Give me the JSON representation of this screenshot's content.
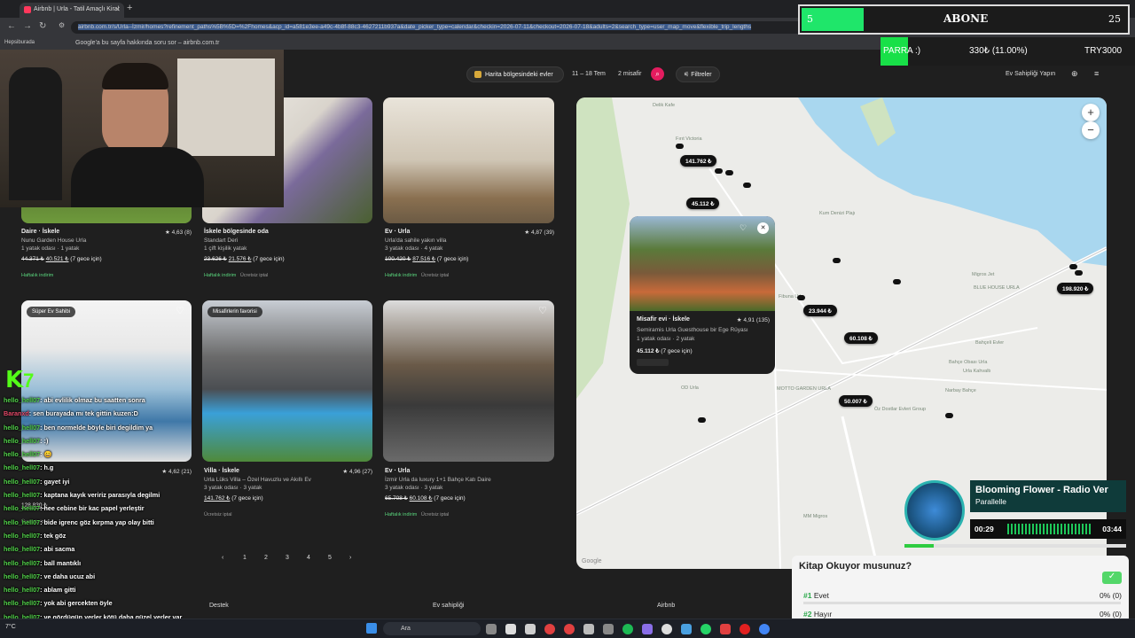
{
  "browser": {
    "tab_title": "Airbnb | Urla - Tatil Amaçlı Kiral",
    "url": "airbnb.com.tr/s/Urla--İzmir/homes?refinement_paths%5B%5D=%2Fhomes&acp_id=a581e3ee-a49c-4b8f-88c3-4627211b937a&date_picker_type=calendar&checkin=2026-07-11&checkout=2026-07-18&adults=2&search_type=user_map_move&flexible_trip_lengths",
    "bookmark_1": "Hepsiburada",
    "bookmark_2": "Google'a bu sayfa hakkında soru sor – airbnb.com.tr"
  },
  "header": {
    "map_area_label": "Harita bölgesindeki evler",
    "dates": "11 – 18 Tem",
    "guests": "2 misafir",
    "filters": "Filtreler",
    "host_link": "Ev Sahipliği Yapın"
  },
  "cards": [
    {
      "title": "Daire · İskele",
      "rating": "★ 4,63 (8)",
      "line1": "Nunu Garden House Urla",
      "line2": "1 yatak odası · 1 yatak",
      "old_price": "44.371 ₺",
      "price": "40.521 ₺",
      "price_note": "(7 gece için)",
      "badge": "Haftalık indirim",
      "badge2": ""
    },
    {
      "title": "İskele bölgesinde oda",
      "rating": "",
      "line1": "Standart Deri",
      "line2": "1 çift kişilik yatak",
      "old_price": "23.626 ₺",
      "price": "21.576 ₺",
      "price_note": "(7 gece için)",
      "badge": "Haftalık indirim",
      "badge2": "Ücretsiz iptal"
    },
    {
      "title": "Ev · Urla",
      "rating": "★ 4,87 (39)",
      "line1": "Urla'da sahile yakın villa",
      "line2": "3 yatak odası · 4 yatak",
      "old_price": "100.420 ₺",
      "price": "87.516 ₺",
      "price_note": "(7 gece için)",
      "badge": "Haftalık indirim",
      "badge2": "Ücretsiz iptal"
    },
    {
      "title": "",
      "rating": "★ 4,62 (21)",
      "line1": "",
      "line2": "",
      "old_price": "",
      "price": "128.830 ₺",
      "price_note": "",
      "badge": "",
      "badge2": "Ücretsiz iptal",
      "tag": "Süper Ev Sahibi"
    },
    {
      "title": "Villa · İskele",
      "rating": "★ 4,96 (27)",
      "line1": "Urla Lüks Villa – Özel Havuzlu ve Akıllı Ev",
      "line2": "3 yatak odası · 3 yatak",
      "old_price": "",
      "price": "141.762 ₺",
      "price_note": "(7 gece için)",
      "badge": "",
      "badge2": "Ücretsiz iptal",
      "tag": "Misafirlerin favorisi"
    },
    {
      "title": "Ev · Urla",
      "rating": "",
      "line1": "İzmir Urla da luxury 1+1 Bahçe Katı Daire",
      "line2": "3 yatak odası · 3 yatak",
      "old_price": "65.708 ₺",
      "price": "60.108 ₺",
      "price_note": "(7 gece için)",
      "badge": "Haftalık indirim",
      "badge2": "Ücretsiz iptal"
    }
  ],
  "pagination": [
    "1",
    "2",
    "3",
    "4",
    "5"
  ],
  "footer": {
    "c1": "Destek",
    "c2": "Ev sahipliği",
    "c3": "Airbnb"
  },
  "map": {
    "prices": [
      "141.762 ₺",
      "45.112 ₺",
      "23.944 ₺",
      "60.108 ₺",
      "198.920 ₺",
      "50.007 ₺"
    ],
    "places": [
      "Delik Kafe",
      "Fırıt Victoria",
      "Kum Denizi Plajı",
      "Migros Jet",
      "BLUE HOUSE URLA",
      "Bahçeli Evler",
      "Bahçe Obası Urla",
      "Urla Kahvaltı",
      "Narbay Bahçe",
      "OD Urla",
      "MOTTO GARDEN URLA",
      "Öz Dostlar Evleri Group",
      "MM Migros",
      "Fibuna Urla"
    ],
    "attribution": "Google",
    "popup": {
      "title": "Misafir evi · İskele",
      "rating": "★ 4,91 (135)",
      "line1": "Semiramis Urla Guesthouse bir Ege Rüyası",
      "line2": "1 yatak odası · 2 yatak",
      "price": "45.112 ₺",
      "price_note": "(7 gece için)"
    }
  },
  "overlay": {
    "abone_left": "5",
    "abone_label": "ABONE",
    "abone_right": "25",
    "para_label": "PARRA :)",
    "para_value": "330₺ (11.00%)",
    "para_goal": "TRY3000",
    "kick_logo": "K",
    "kick_count": "7"
  },
  "chat": [
    {
      "user": "hello_hell07",
      "msg": ": abi evlilik olmaz bu saatten sonra"
    },
    {
      "user": "Baranxd",
      "msg": ": sen burayada mı tek gittin kuzen:D"
    },
    {
      "user": "hello_hell07",
      "msg": ": ben normelde böyle biri degildim ya"
    },
    {
      "user": "hello_hell07",
      "msg": ": :)"
    },
    {
      "user": "hello_hell07",
      "msg": ": 😀"
    },
    {
      "user": "hello_hell07",
      "msg": ": h.g"
    },
    {
      "user": "hello_hell07",
      "msg": ": gayet iyi"
    },
    {
      "user": "hello_hell07",
      "msg": ": kaptana kayık veririz parasıyla degilmi"
    },
    {
      "user": "hello_hell07",
      "msg": ": hee cebine bir kac papel yerleştir"
    },
    {
      "user": "hello_hell07",
      "msg": ": bide igrenc göz kırpma yap olay bitti"
    },
    {
      "user": "hello_hell07",
      "msg": ": tek göz"
    },
    {
      "user": "hello_hell07",
      "msg": ": abi sacma"
    },
    {
      "user": "hello_hell07",
      "msg": ": ball mantıklı"
    },
    {
      "user": "hello_hell07",
      "msg": ": ve daha ucuz abi"
    },
    {
      "user": "hello_hell07",
      "msg": ": ablam gitti"
    },
    {
      "user": "hello_hell07",
      "msg": ": yok abi gercekten öyle"
    },
    {
      "user": "hello_hell07",
      "msg": ": ve gördügün yerler kötü daha güzel yerler var"
    }
  ],
  "music": {
    "title": "Blooming Flower - Radio Ver",
    "artist": "Parallelle",
    "elapsed": "00:29",
    "total": "03:44",
    "progress": 0.13
  },
  "poll": {
    "question": "Kitap Okuyor musunuz?",
    "opt1_num": "#1",
    "opt1": "Evet",
    "opt1_pct": "0% (0)",
    "opt2_num": "#2",
    "opt2": "Hayır",
    "opt2_pct": "0% (0)"
  },
  "taskbar": {
    "search": "Ara",
    "temp": "7°C"
  }
}
